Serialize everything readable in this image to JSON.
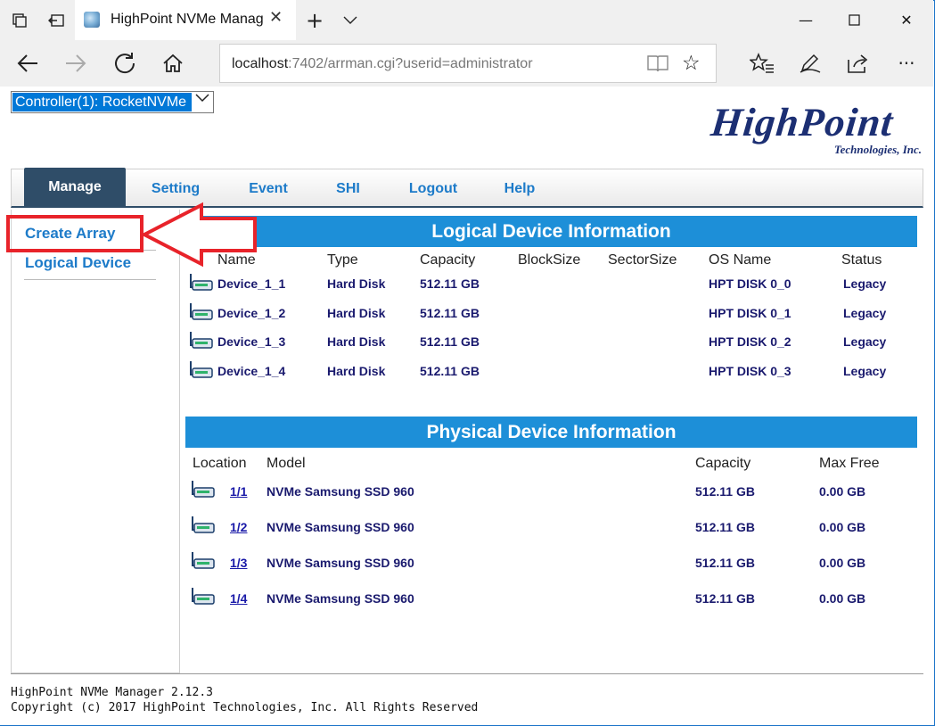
{
  "browser": {
    "tab_title": "HighPoint NVMe Manag",
    "address_host": "localhost",
    "address_path": ":7402/arrman.cgi?userid=administrator"
  },
  "icons": {
    "tab_actions": "tab-actions-icon",
    "set_aside": "set-aside-tabs-icon",
    "back": "back-arrow-icon",
    "forward": "forward-arrow-icon",
    "refresh": "refresh-icon",
    "home": "home-icon",
    "reading": "reading-view-icon",
    "favorite": "star-icon",
    "favorites_hub": "favorites-hub-icon",
    "notes": "pen-icon",
    "share": "share-icon",
    "more": "more-icon"
  },
  "controller": {
    "selected": "Controller(1): RocketNVMe"
  },
  "logo": {
    "main": "HighPoint",
    "sub": "Technologies, Inc."
  },
  "nav": [
    "Manage",
    "Setting",
    "Event",
    "SHI",
    "Logout",
    "Help"
  ],
  "sidebar": {
    "create_array": "Create Array",
    "logical_device": "Logical Device"
  },
  "logical": {
    "heading": "Logical Device Information",
    "headers": [
      "Name",
      "Type",
      "Capacity",
      "BlockSize",
      "SectorSize",
      "OS Name",
      "Status"
    ],
    "rows": [
      {
        "name": "Device_1_1",
        "type": "Hard Disk",
        "capacity": "512.11 GB",
        "os_name": "HPT DISK 0_0",
        "status": "Legacy"
      },
      {
        "name": "Device_1_2",
        "type": "Hard Disk",
        "capacity": "512.11 GB",
        "os_name": "HPT DISK 0_1",
        "status": "Legacy"
      },
      {
        "name": "Device_1_3",
        "type": "Hard Disk",
        "capacity": "512.11 GB",
        "os_name": "HPT DISK 0_2",
        "status": "Legacy"
      },
      {
        "name": "Device_1_4",
        "type": "Hard Disk",
        "capacity": "512.11 GB",
        "os_name": "HPT DISK 0_3",
        "status": "Legacy"
      }
    ]
  },
  "physical": {
    "heading": "Physical Device Information",
    "headers": [
      "Location",
      "Model",
      "Capacity",
      "Max Free"
    ],
    "rows": [
      {
        "location": "1/1",
        "model": "NVMe Samsung SSD 960",
        "capacity": "512.11 GB",
        "max_free": "0.00 GB"
      },
      {
        "location": "1/2",
        "model": "NVMe Samsung SSD 960",
        "capacity": "512.11 GB",
        "max_free": "0.00 GB"
      },
      {
        "location": "1/3",
        "model": "NVMe Samsung SSD 960",
        "capacity": "512.11 GB",
        "max_free": "0.00 GB"
      },
      {
        "location": "1/4",
        "model": "NVMe Samsung SSD 960",
        "capacity": "512.11 GB",
        "max_free": "0.00 GB"
      }
    ]
  },
  "footer": {
    "version": "HighPoint NVMe Manager 2.12.3",
    "copyright": "Copyright (c) 2017 HighPoint Technologies, Inc. All Rights Reserved"
  },
  "colors": {
    "accent": "#1d8fd8",
    "nav_active": "#2f4d68",
    "link": "#1d7bc9",
    "data_text": "#1a1a6e",
    "annotation": "#e8232a"
  }
}
